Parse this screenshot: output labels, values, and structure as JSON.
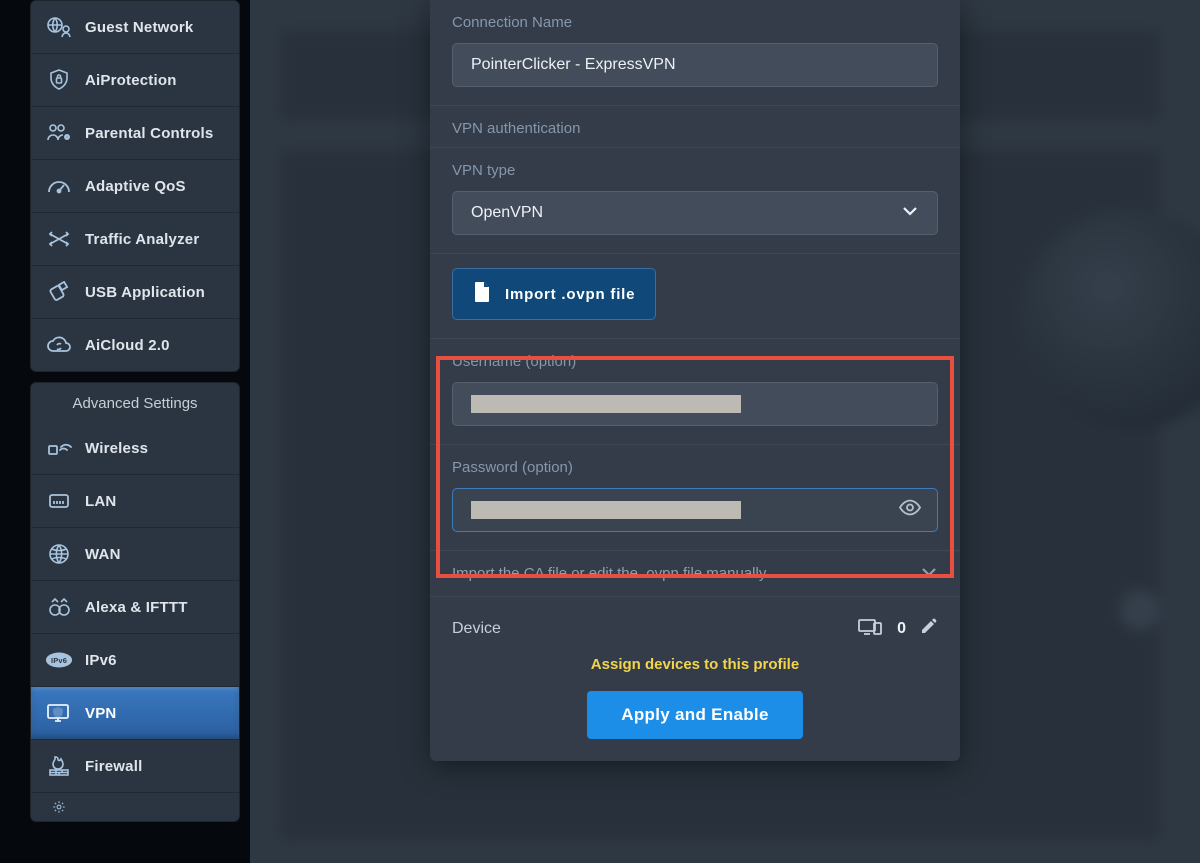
{
  "sidebar": {
    "general": [
      {
        "id": "guest-network",
        "label": "Guest Network",
        "icon": "globe-people"
      },
      {
        "id": "aiprotection",
        "label": "AiProtection",
        "icon": "shield-lock"
      },
      {
        "id": "parental",
        "label": "Parental Controls",
        "icon": "people-lock"
      },
      {
        "id": "adaptive-qos",
        "label": "Adaptive QoS",
        "icon": "gauge"
      },
      {
        "id": "traffic",
        "label": "Traffic Analyzer",
        "icon": "crossed-arrows"
      },
      {
        "id": "usb-app",
        "label": "USB Application",
        "icon": "usb"
      },
      {
        "id": "aicloud",
        "label": "AiCloud 2.0",
        "icon": "cloud-sync"
      }
    ],
    "advanced_title": "Advanced Settings",
    "advanced": [
      {
        "id": "wireless",
        "label": "Wireless",
        "icon": "wifi"
      },
      {
        "id": "lan",
        "label": "LAN",
        "icon": "ethernet"
      },
      {
        "id": "wan",
        "label": "WAN",
        "icon": "globe-grid"
      },
      {
        "id": "alexa",
        "label": "Alexa & IFTTT",
        "icon": "alexa"
      },
      {
        "id": "ipv6",
        "label": "IPv6",
        "icon": "ipv6-badge"
      },
      {
        "id": "vpn",
        "label": "VPN",
        "icon": "monitor-shield",
        "active": true
      },
      {
        "id": "firewall",
        "label": "Firewall",
        "icon": "flame-wall"
      }
    ]
  },
  "dialog": {
    "connection_name_label": "Connection Name",
    "connection_name_value": "PointerClicker - ExpressVPN",
    "auth_section_label": "VPN authentication",
    "vpn_type_label": "VPN type",
    "vpn_type_value": "OpenVPN",
    "import_label": "Import .ovpn file",
    "username_label": "Username (option)",
    "password_label": "Password (option)",
    "manual_text": "Import the CA file or edit the .ovpn file manually.",
    "device_label": "Device",
    "device_count": "0",
    "assign_label": "Assign devices to this profile",
    "apply_label": "Apply and Enable"
  }
}
